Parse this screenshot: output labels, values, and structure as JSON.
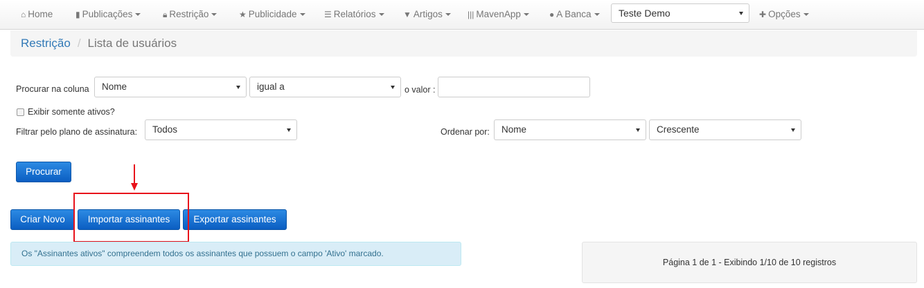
{
  "navbar": {
    "items": [
      {
        "label": "Home",
        "icon": "home-icon"
      },
      {
        "label": "Publicações",
        "icon": "file-icon"
      },
      {
        "label": "Restrição",
        "icon": "lock-icon"
      },
      {
        "label": "Publicidade",
        "icon": "star-icon"
      },
      {
        "label": "Relatórios",
        "icon": "list-icon"
      },
      {
        "label": "Artigos",
        "icon": "bookmark-icon"
      },
      {
        "label": "MavenApp",
        "icon": "barcode-icon"
      },
      {
        "label": "A Banca",
        "icon": "globe-icon"
      }
    ],
    "account_select": "Teste Demo",
    "options_label": "Opções",
    "options_icon": "plus-icon"
  },
  "breadcrumb": {
    "parent": "Restrição",
    "separator": "/",
    "current": "Lista de usuários"
  },
  "search": {
    "column_label": "Procurar na coluna",
    "column_value": "Nome",
    "operator_value": "igual a",
    "value_label": "o valor :",
    "value_input": "",
    "active_only_label": "Exibir somente ativos?",
    "active_only_checked": false,
    "plan_label": "Filtrar pelo plano de assinatura:",
    "plan_value": "Todos",
    "order_label": "Ordenar por:",
    "order_field": "Nome",
    "order_direction": "Crescente",
    "search_button": "Procurar"
  },
  "actions": {
    "create": "Criar Novo",
    "import": "Importar assinantes",
    "export": "Exportar assinantes"
  },
  "info_text": "Os \"Assinantes ativos\" compreendem todos os assinantes que possuem o campo 'Ativo' marcado.",
  "pagination_text": "Página 1 de 1 - Exibindo 1/10 de 10 registros",
  "colors": {
    "primary": "#0b5ec2",
    "link": "#337ab7",
    "annotation": "#e8121b",
    "info_bg": "#d9edf7"
  }
}
